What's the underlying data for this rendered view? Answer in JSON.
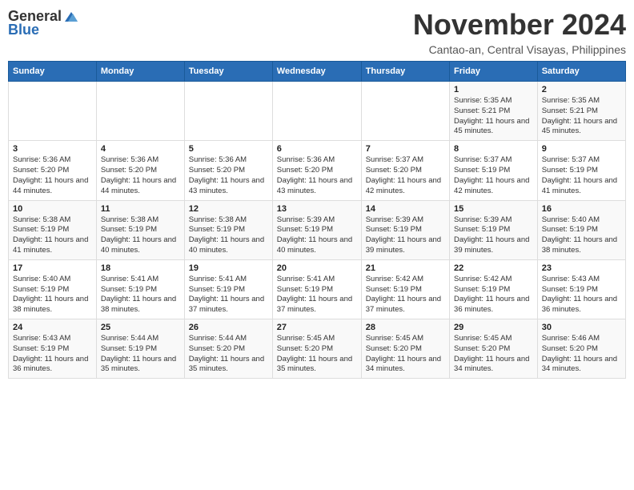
{
  "header": {
    "logo_general": "General",
    "logo_blue": "Blue",
    "month_title": "November 2024",
    "location": "Cantao-an, Central Visayas, Philippines"
  },
  "weekdays": [
    "Sunday",
    "Monday",
    "Tuesday",
    "Wednesday",
    "Thursday",
    "Friday",
    "Saturday"
  ],
  "weeks": [
    [
      {
        "day": "",
        "info": ""
      },
      {
        "day": "",
        "info": ""
      },
      {
        "day": "",
        "info": ""
      },
      {
        "day": "",
        "info": ""
      },
      {
        "day": "",
        "info": ""
      },
      {
        "day": "1",
        "info": "Sunrise: 5:35 AM\nSunset: 5:21 PM\nDaylight: 11 hours and 45 minutes."
      },
      {
        "day": "2",
        "info": "Sunrise: 5:35 AM\nSunset: 5:21 PM\nDaylight: 11 hours and 45 minutes."
      }
    ],
    [
      {
        "day": "3",
        "info": "Sunrise: 5:36 AM\nSunset: 5:20 PM\nDaylight: 11 hours and 44 minutes."
      },
      {
        "day": "4",
        "info": "Sunrise: 5:36 AM\nSunset: 5:20 PM\nDaylight: 11 hours and 44 minutes."
      },
      {
        "day": "5",
        "info": "Sunrise: 5:36 AM\nSunset: 5:20 PM\nDaylight: 11 hours and 43 minutes."
      },
      {
        "day": "6",
        "info": "Sunrise: 5:36 AM\nSunset: 5:20 PM\nDaylight: 11 hours and 43 minutes."
      },
      {
        "day": "7",
        "info": "Sunrise: 5:37 AM\nSunset: 5:20 PM\nDaylight: 11 hours and 42 minutes."
      },
      {
        "day": "8",
        "info": "Sunrise: 5:37 AM\nSunset: 5:19 PM\nDaylight: 11 hours and 42 minutes."
      },
      {
        "day": "9",
        "info": "Sunrise: 5:37 AM\nSunset: 5:19 PM\nDaylight: 11 hours and 41 minutes."
      }
    ],
    [
      {
        "day": "10",
        "info": "Sunrise: 5:38 AM\nSunset: 5:19 PM\nDaylight: 11 hours and 41 minutes."
      },
      {
        "day": "11",
        "info": "Sunrise: 5:38 AM\nSunset: 5:19 PM\nDaylight: 11 hours and 40 minutes."
      },
      {
        "day": "12",
        "info": "Sunrise: 5:38 AM\nSunset: 5:19 PM\nDaylight: 11 hours and 40 minutes."
      },
      {
        "day": "13",
        "info": "Sunrise: 5:39 AM\nSunset: 5:19 PM\nDaylight: 11 hours and 40 minutes."
      },
      {
        "day": "14",
        "info": "Sunrise: 5:39 AM\nSunset: 5:19 PM\nDaylight: 11 hours and 39 minutes."
      },
      {
        "day": "15",
        "info": "Sunrise: 5:39 AM\nSunset: 5:19 PM\nDaylight: 11 hours and 39 minutes."
      },
      {
        "day": "16",
        "info": "Sunrise: 5:40 AM\nSunset: 5:19 PM\nDaylight: 11 hours and 38 minutes."
      }
    ],
    [
      {
        "day": "17",
        "info": "Sunrise: 5:40 AM\nSunset: 5:19 PM\nDaylight: 11 hours and 38 minutes."
      },
      {
        "day": "18",
        "info": "Sunrise: 5:41 AM\nSunset: 5:19 PM\nDaylight: 11 hours and 38 minutes."
      },
      {
        "day": "19",
        "info": "Sunrise: 5:41 AM\nSunset: 5:19 PM\nDaylight: 11 hours and 37 minutes."
      },
      {
        "day": "20",
        "info": "Sunrise: 5:41 AM\nSunset: 5:19 PM\nDaylight: 11 hours and 37 minutes."
      },
      {
        "day": "21",
        "info": "Sunrise: 5:42 AM\nSunset: 5:19 PM\nDaylight: 11 hours and 37 minutes."
      },
      {
        "day": "22",
        "info": "Sunrise: 5:42 AM\nSunset: 5:19 PM\nDaylight: 11 hours and 36 minutes."
      },
      {
        "day": "23",
        "info": "Sunrise: 5:43 AM\nSunset: 5:19 PM\nDaylight: 11 hours and 36 minutes."
      }
    ],
    [
      {
        "day": "24",
        "info": "Sunrise: 5:43 AM\nSunset: 5:19 PM\nDaylight: 11 hours and 36 minutes."
      },
      {
        "day": "25",
        "info": "Sunrise: 5:44 AM\nSunset: 5:19 PM\nDaylight: 11 hours and 35 minutes."
      },
      {
        "day": "26",
        "info": "Sunrise: 5:44 AM\nSunset: 5:20 PM\nDaylight: 11 hours and 35 minutes."
      },
      {
        "day": "27",
        "info": "Sunrise: 5:45 AM\nSunset: 5:20 PM\nDaylight: 11 hours and 35 minutes."
      },
      {
        "day": "28",
        "info": "Sunrise: 5:45 AM\nSunset: 5:20 PM\nDaylight: 11 hours and 34 minutes."
      },
      {
        "day": "29",
        "info": "Sunrise: 5:45 AM\nSunset: 5:20 PM\nDaylight: 11 hours and 34 minutes."
      },
      {
        "day": "30",
        "info": "Sunrise: 5:46 AM\nSunset: 5:20 PM\nDaylight: 11 hours and 34 minutes."
      }
    ]
  ]
}
